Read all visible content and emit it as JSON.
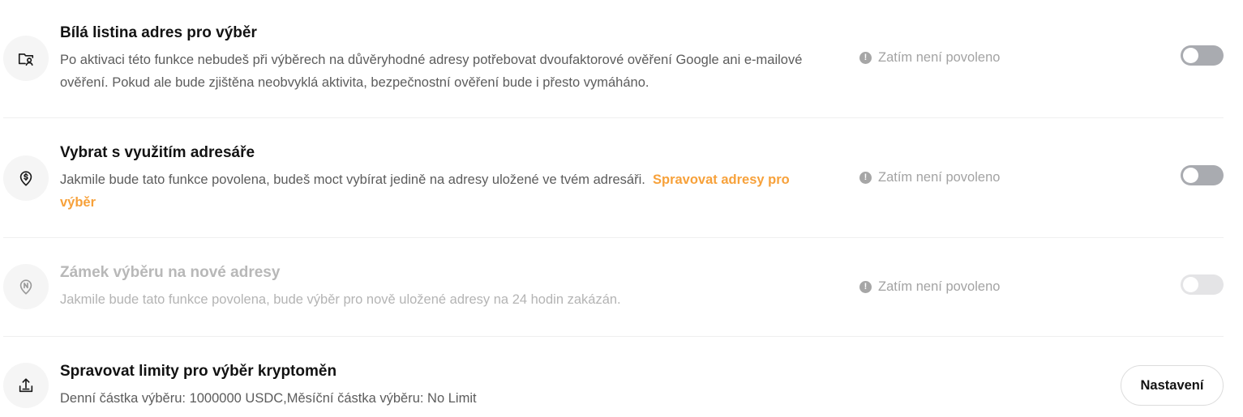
{
  "settings": [
    {
      "title": "Bílá listina adres pro výběr",
      "description": "Po aktivaci této funkce nebudeš při výběrech na důvěryhodné adresy potřebovat dvoufaktorové ověření Google ani e-mailové ověření. Pokud ale bude zjištěna neobvyklá aktivita, bezpečnostní ověření bude i přesto vymáháno.",
      "status": "Zatím není povoleno",
      "icon": "address-whitelist-icon",
      "toggle_state": "off"
    },
    {
      "title": "Vybrat s využitím adresáře",
      "description": "Jakmile bude tato funkce povolena, budeš moct vybírat jedině na adresy uložené ve tvém adresáři.",
      "link": "Spravovat adresy pro výběr",
      "status": "Zatím není povoleno",
      "icon": "location-dollar-icon",
      "toggle_state": "off"
    },
    {
      "title": "Zámek výběru na nové adresy",
      "description": "Jakmile bude tato funkce povolena, bude výběr pro nově uložené adresy na 24 hodin zakázán.",
      "status": "Zatím není povoleno",
      "icon": "location-new-icon",
      "toggle_state": "off-disabled"
    },
    {
      "title": "Spravovat limity pro výběr kryptoměn",
      "description": "Denní částka výběru: 1000000 USDC,Měsíční částka výběru: No Limit",
      "button": "Nastavení",
      "icon": "upload-tray-icon"
    }
  ],
  "colors": {
    "link": "#f7a13a",
    "toggle_off": "#a9abb0",
    "toggle_disabled": "#e4e4e6",
    "status_text": "#a3a3a3"
  },
  "status_icon": "exclamation-icon"
}
